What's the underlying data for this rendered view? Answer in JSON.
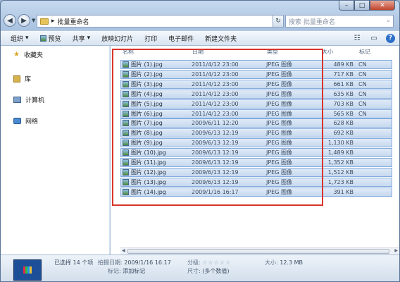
{
  "window": {
    "address_path": "批量重命名",
    "search_placeholder": "搜索 批量重命名",
    "buttons": {
      "minimize": "–",
      "maximize": "□",
      "close": "✕"
    }
  },
  "toolbar": {
    "organize": "组织",
    "preview": "预览",
    "share": "共享",
    "slideshow": "放映幻灯片",
    "print": "打印",
    "email": "电子邮件",
    "new_folder": "新建文件夹"
  },
  "nav": {
    "favorites": "收藏夹",
    "libraries": "库",
    "computer": "计算机",
    "network": "网络"
  },
  "columns": {
    "name": "名称",
    "date": "日期",
    "type": "类型",
    "size": "大小",
    "tag": "标记"
  },
  "files": [
    {
      "name": "图片 (1).jpg",
      "date": "2011/4/12 23:00",
      "type": "JPEG 图像",
      "size": "489 KB",
      "tag": "CN"
    },
    {
      "name": "图片 (2).jpg",
      "date": "2011/4/12 23:00",
      "type": "JPEG 图像",
      "size": "717 KB",
      "tag": "CN"
    },
    {
      "name": "图片 (3).jpg",
      "date": "2011/4/12 23:00",
      "type": "JPEG 图像",
      "size": "661 KB",
      "tag": "CN"
    },
    {
      "name": "图片 (4).jpg",
      "date": "2011/4/12 23:00",
      "type": "JPEG 图像",
      "size": "635 KB",
      "tag": "CN"
    },
    {
      "name": "图片 (5).jpg",
      "date": "2011/4/12 23:00",
      "type": "JPEG 图像",
      "size": "703 KB",
      "tag": "CN"
    },
    {
      "name": "图片 (6).jpg",
      "date": "2011/4/12 23:00",
      "type": "JPEG 图像",
      "size": "565 KB",
      "tag": "CN"
    },
    {
      "name": "图片 (7).jpg",
      "date": "2009/6/11 12:20",
      "type": "JPEG 图像",
      "size": "628 KB",
      "tag": ""
    },
    {
      "name": "图片 (8).jpg",
      "date": "2009/6/13 12:19",
      "type": "JPEG 图像",
      "size": "692 KB",
      "tag": ""
    },
    {
      "name": "图片 (9).jpg",
      "date": "2009/6/13 12:19",
      "type": "JPEG 图像",
      "size": "1,130 KB",
      "tag": ""
    },
    {
      "name": "图片 (10).jpg",
      "date": "2009/6/13 12:19",
      "type": "JPEG 图像",
      "size": "1,489 KB",
      "tag": ""
    },
    {
      "name": "图片 (11).jpg",
      "date": "2009/6/13 12:19",
      "type": "JPEG 图像",
      "size": "1,352 KB",
      "tag": ""
    },
    {
      "name": "图片 (12).jpg",
      "date": "2009/6/13 12:19",
      "type": "JPEG 图像",
      "size": "1,512 KB",
      "tag": ""
    },
    {
      "name": "图片 (13).jpg",
      "date": "2009/6/13 12:19",
      "type": "JPEG 图像",
      "size": "1,723 KB",
      "tag": ""
    },
    {
      "name": "图片 (14).jpg",
      "date": "2009/1/16 16:17",
      "type": "JPEG 图像",
      "size": "391 KB",
      "tag": ""
    }
  ],
  "details": {
    "selected": "已选择 14 个项",
    "date_taken_label": "拍摄日期:",
    "date_taken": "2009/1/16 16:17",
    "tags_label": "标记:",
    "tags_value": "添加标记",
    "rating_label": "分级:",
    "rating": "☆☆☆☆☆",
    "dims_label": "尺寸:",
    "dims_value": "(多个数值)",
    "size_label": "大小:",
    "size_value": "12.3 MB"
  }
}
